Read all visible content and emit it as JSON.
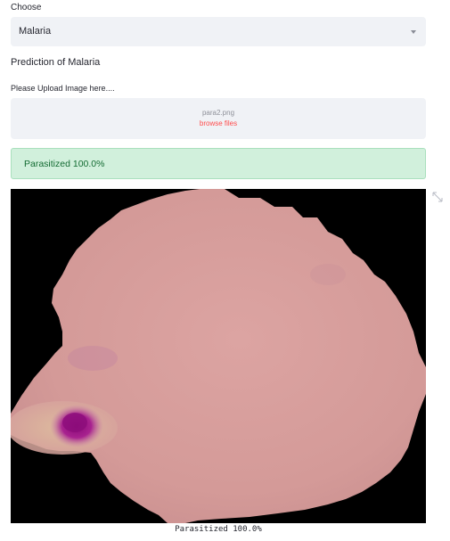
{
  "select": {
    "label": "Choose",
    "value": "Malaria"
  },
  "heading": "Prediction of Malaria",
  "uploader": {
    "label": "Please Upload Image here....",
    "file_name": "para2.png",
    "browse_label": "browse files"
  },
  "result": {
    "alert_text": "Parasitized 100.0%",
    "caption": "Parasitized 100.0%"
  },
  "colors": {
    "accent": "#ff4b4b",
    "success_bg": "#d1f0dc",
    "success_text": "#136b32",
    "cell": "#d59c9a",
    "parasite": "#a01a8c"
  },
  "icons": {
    "select_caret": "chevron-down-icon",
    "expand": "fullscreen-icon"
  }
}
